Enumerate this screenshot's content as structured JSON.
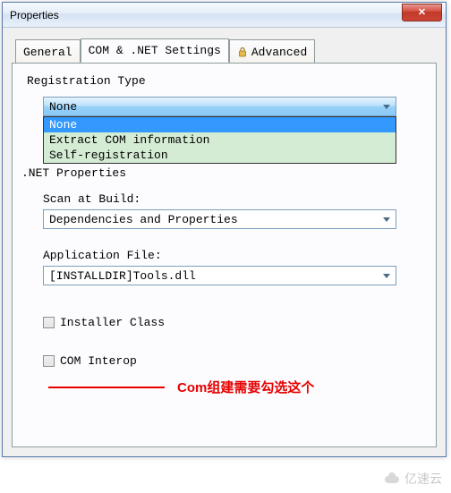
{
  "window": {
    "title": "Properties",
    "close_symbol": "✕"
  },
  "tabs": {
    "general": "General",
    "com_net": "COM & .NET Settings",
    "advanced": "Advanced"
  },
  "registration": {
    "label": "Registration Type",
    "selected": "None",
    "options": [
      "None",
      "Extract COM information",
      "Self-registration"
    ]
  },
  "net_props": {
    "label": ".NET Properties",
    "scan_label": "Scan at Build:",
    "scan_value": "Dependencies and Properties",
    "appfile_label": "Application File:",
    "appfile_value": "[INSTALLDIR]Tools.dll",
    "installer_class": "Installer Class",
    "com_interop": "COM Interop"
  },
  "annotation": "Com组建需要勾选这个",
  "watermark": "亿速云"
}
